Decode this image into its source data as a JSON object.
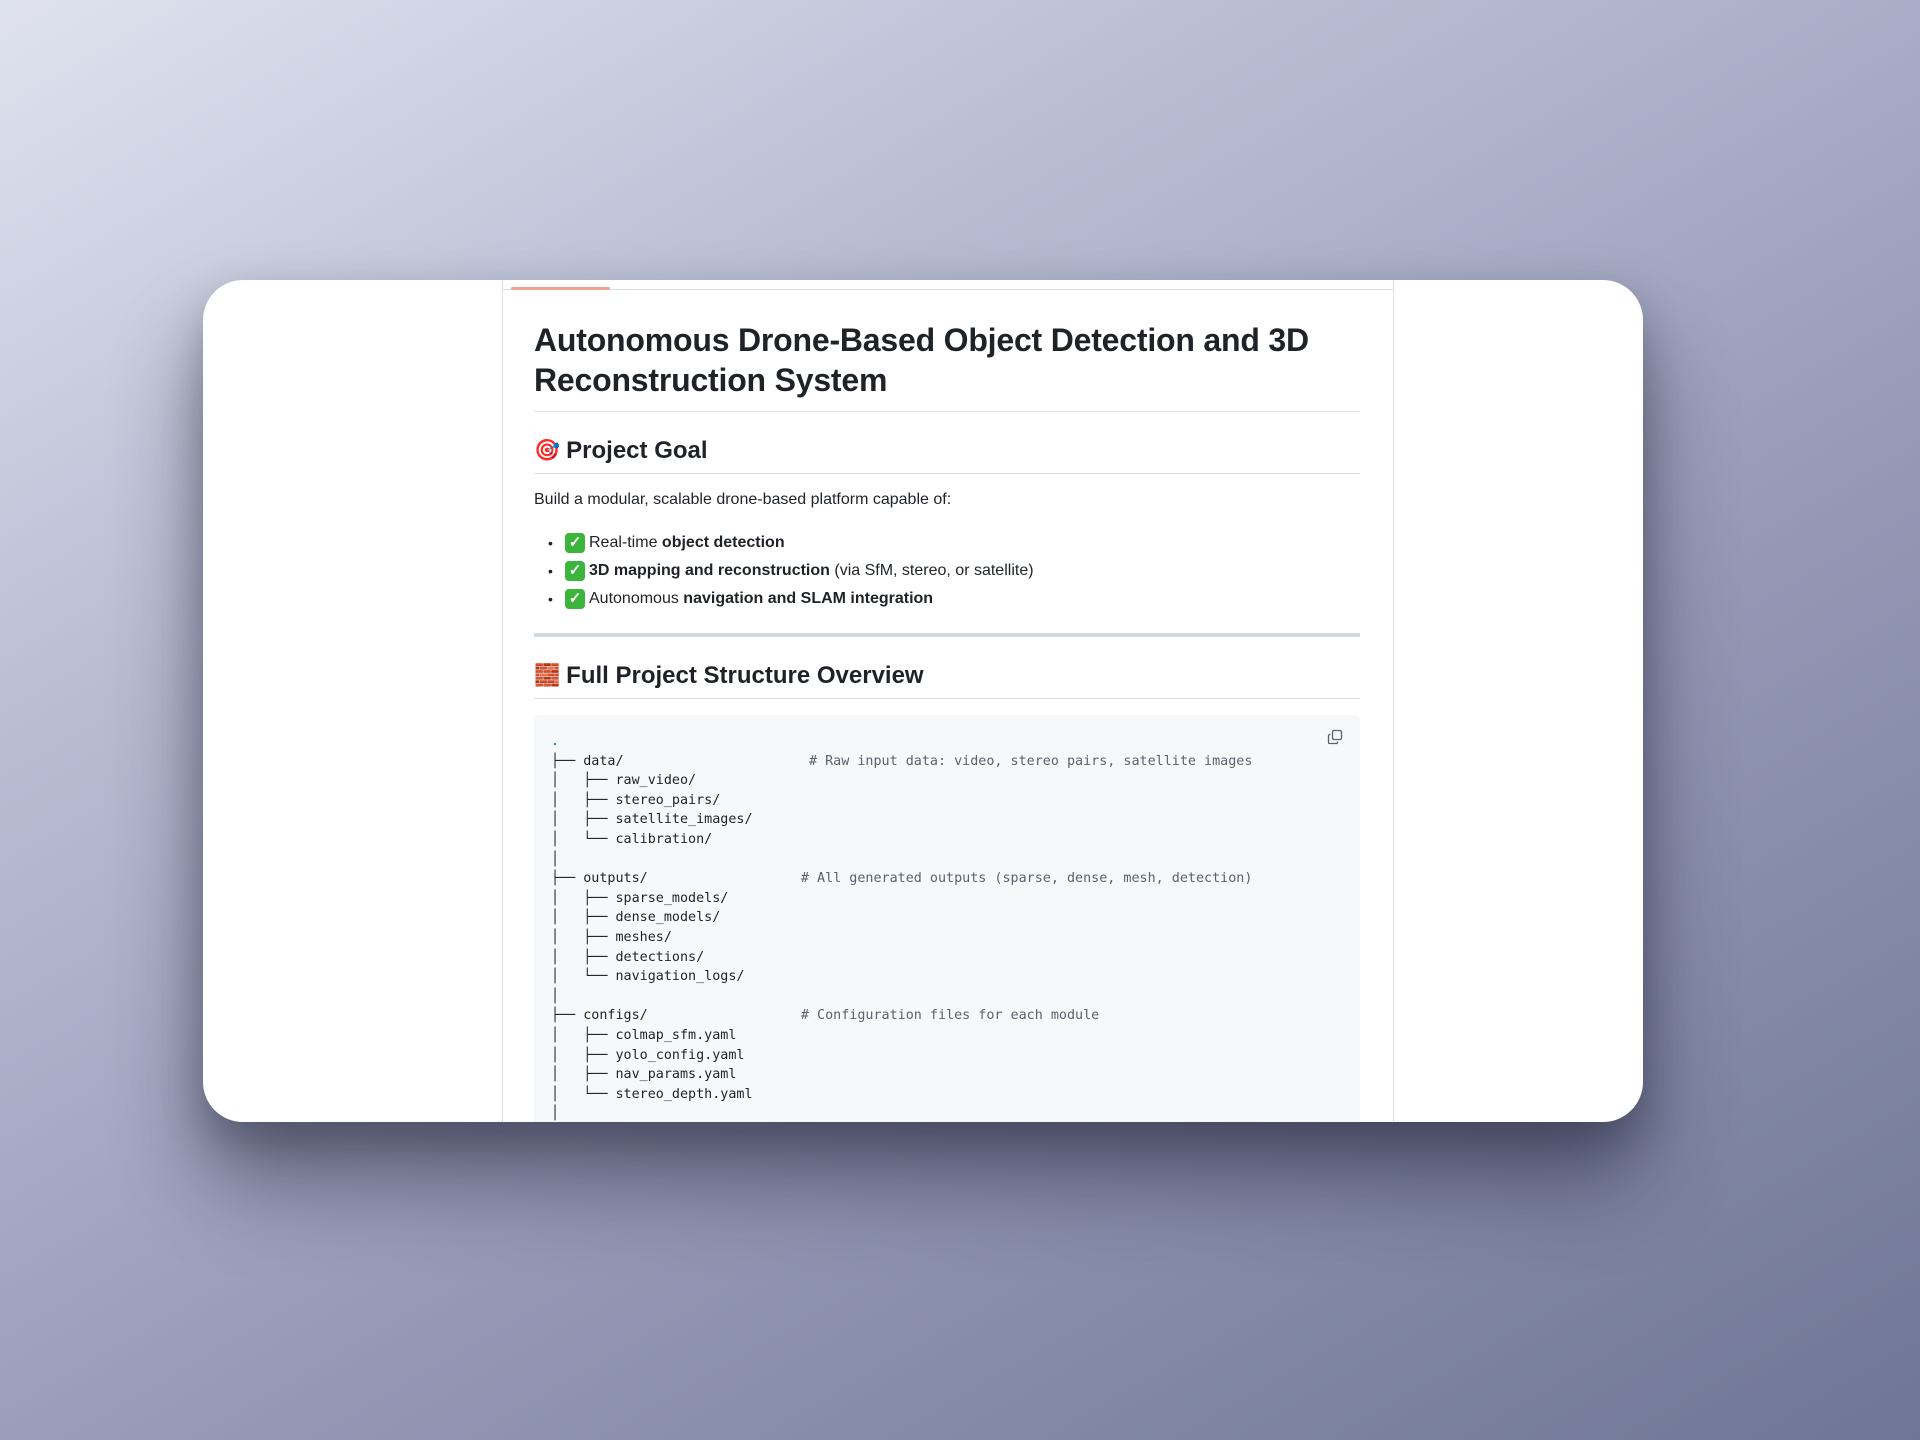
{
  "document": {
    "title": "Autonomous Drone-Based Object Detection and 3D Reconstruction System",
    "goal_section": {
      "emoji": "🎯",
      "heading": "Project Goal",
      "intro": "Build a modular, scalable drone-based platform capable of:",
      "items": [
        {
          "check": "✓",
          "prefix": "Real-time ",
          "bold": "object detection",
          "suffix": ""
        },
        {
          "check": "✓",
          "prefix": "",
          "bold": "3D mapping and reconstruction",
          "suffix": " (via SfM, stereo, or satellite)"
        },
        {
          "check": "✓",
          "prefix": "Autonomous ",
          "bold": "navigation and SLAM integration",
          "suffix": ""
        }
      ]
    },
    "structure_section": {
      "emoji": "🧱",
      "heading": "Full Project Structure Overview",
      "code": {
        "root": ".",
        "lines": [
          {
            "text": "├── data/                       ",
            "comment": "# Raw input data: video, stereo pairs, satellite images"
          },
          {
            "text": "│   ├── raw_video/",
            "comment": ""
          },
          {
            "text": "│   ├── stereo_pairs/",
            "comment": ""
          },
          {
            "text": "│   ├── satellite_images/",
            "comment": ""
          },
          {
            "text": "│   └── calibration/",
            "comment": ""
          },
          {
            "text": "│",
            "comment": ""
          },
          {
            "text": "├── outputs/                   ",
            "comment": "# All generated outputs (sparse, dense, mesh, detection)"
          },
          {
            "text": "│   ├── sparse_models/",
            "comment": ""
          },
          {
            "text": "│   ├── dense_models/",
            "comment": ""
          },
          {
            "text": "│   ├── meshes/",
            "comment": ""
          },
          {
            "text": "│   ├── detections/",
            "comment": ""
          },
          {
            "text": "│   └── navigation_logs/",
            "comment": ""
          },
          {
            "text": "│",
            "comment": ""
          },
          {
            "text": "├── configs/                   ",
            "comment": "# Configuration files for each module"
          },
          {
            "text": "│   ├── colmap_sfm.yaml",
            "comment": ""
          },
          {
            "text": "│   ├── yolo_config.yaml",
            "comment": ""
          },
          {
            "text": "│   ├── nav_params.yaml",
            "comment": ""
          },
          {
            "text": "│   └── stereo_depth.yaml",
            "comment": ""
          },
          {
            "text": "│",
            "comment": ""
          }
        ]
      }
    }
  },
  "icons": {
    "copy": "copy-icon"
  },
  "colors": {
    "accent_tab": "#f0a093",
    "check": "#3bb53b",
    "code_bg": "#f6f8fa"
  }
}
